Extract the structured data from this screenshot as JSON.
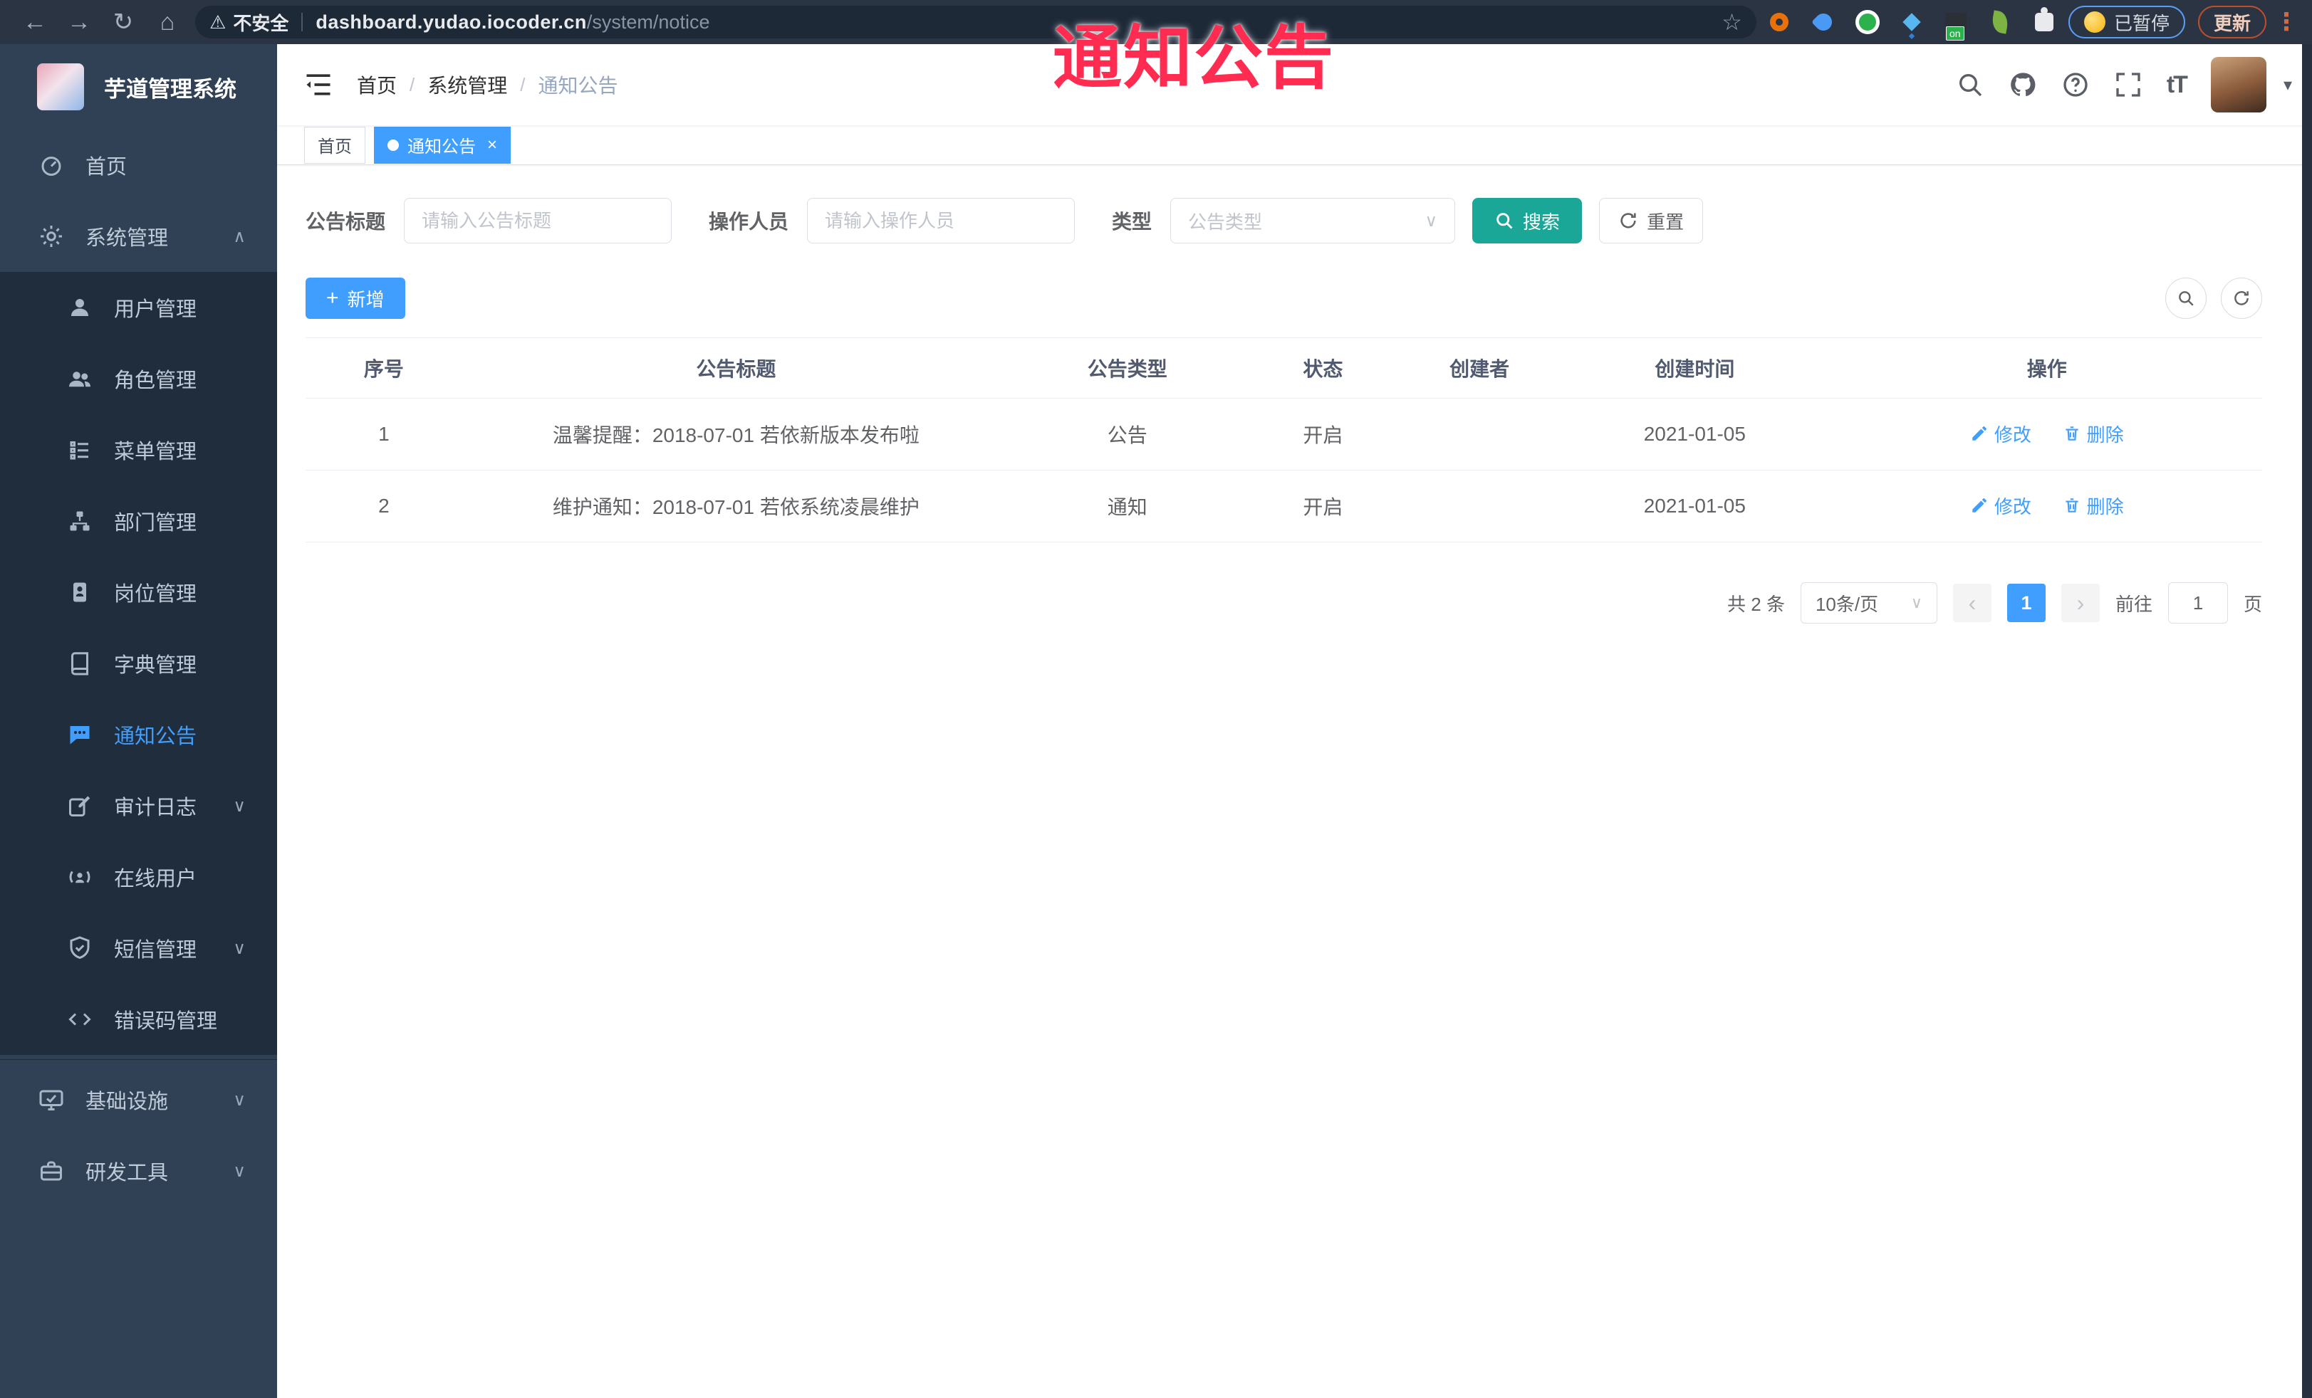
{
  "icons": {
    "back": "←",
    "forward": "→",
    "reload": "↻",
    "home": "⌂",
    "warning": "⚠",
    "star": "☆",
    "menu_dots": "⋮",
    "caret_down": "▾",
    "chevron_up": "∧",
    "chevron_down": "∨",
    "plus": "+",
    "close": "×",
    "prev": "‹",
    "next": "›",
    "slash": "/",
    "font_size": "tT",
    "ext_badge": "on"
  },
  "browser": {
    "security_label": "不安全",
    "url_host": "dashboard.yudao.iocoder.cn",
    "url_path": "/system/notice",
    "paused_badge": "已暂停",
    "update_label": "更新"
  },
  "annotation": {
    "text": "通知公告"
  },
  "sidebar": {
    "title": "芋道管理系统",
    "home": {
      "label": "首页"
    },
    "system": {
      "label": "系统管理"
    },
    "submenu": [
      {
        "label": "用户管理"
      },
      {
        "label": "角色管理"
      },
      {
        "label": "菜单管理"
      },
      {
        "label": "部门管理"
      },
      {
        "label": "岗位管理"
      },
      {
        "label": "字典管理"
      },
      {
        "label": "通知公告"
      },
      {
        "label": "审计日志"
      },
      {
        "label": "在线用户"
      },
      {
        "label": "短信管理"
      },
      {
        "label": "错误码管理"
      }
    ],
    "infra": {
      "label": "基础设施"
    },
    "devtools": {
      "label": "研发工具"
    }
  },
  "header": {
    "breadcrumb": [
      "首页",
      "系统管理",
      "通知公告"
    ]
  },
  "tabs": [
    {
      "label": "首页"
    },
    {
      "label": "通知公告"
    }
  ],
  "filters": {
    "title_label": "公告标题",
    "title_placeholder": "请输入公告标题",
    "operator_label": "操作人员",
    "operator_placeholder": "请输入操作人员",
    "type_label": "类型",
    "type_placeholder": "公告类型",
    "search_label": "搜索",
    "reset_label": "重置"
  },
  "toolbar": {
    "add_label": "新增"
  },
  "table": {
    "headers": [
      "序号",
      "公告标题",
      "公告类型",
      "状态",
      "创建者",
      "创建时间",
      "操作"
    ],
    "rows": [
      {
        "id": "1",
        "title": "温馨提醒：2018-07-01 若依新版本发布啦",
        "type": "公告",
        "status": "开启",
        "creator": "",
        "created_at": "2021-01-05",
        "edit_label": "修改",
        "delete_label": "删除"
      },
      {
        "id": "2",
        "title": "维护通知：2018-07-01 若依系统凌晨维护",
        "type": "通知",
        "status": "开启",
        "creator": "",
        "created_at": "2021-01-05",
        "edit_label": "修改",
        "delete_label": "删除"
      }
    ]
  },
  "pagination": {
    "total_text": "共 2 条",
    "page_size": "10条/页",
    "current_page": "1",
    "goto_label": "前往",
    "goto_value": "1",
    "page_unit": "页"
  },
  "colors": {
    "accent": "#409eff",
    "search_teal": "#1ba797",
    "annotation_red": "#ff2b50"
  }
}
